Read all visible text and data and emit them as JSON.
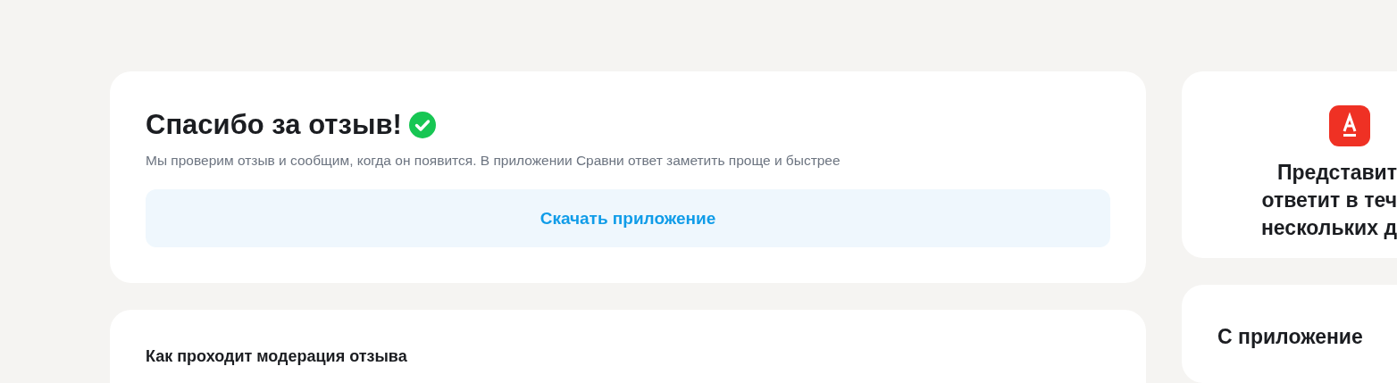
{
  "success_card": {
    "title": "Спасибо за отзыв!",
    "message": "Мы проверим отзыв и сообщим, когда он появится. В приложении Сравни ответ заметить проще и быстрее",
    "button": "Скачать приложение"
  },
  "moderation_card": {
    "title": "Как проходит модерация отзыва"
  },
  "bank_card": {
    "lines": [
      "Представит",
      "ответит в теч",
      "нескольких д"
    ]
  },
  "app_card": {
    "title": "С приложение"
  }
}
